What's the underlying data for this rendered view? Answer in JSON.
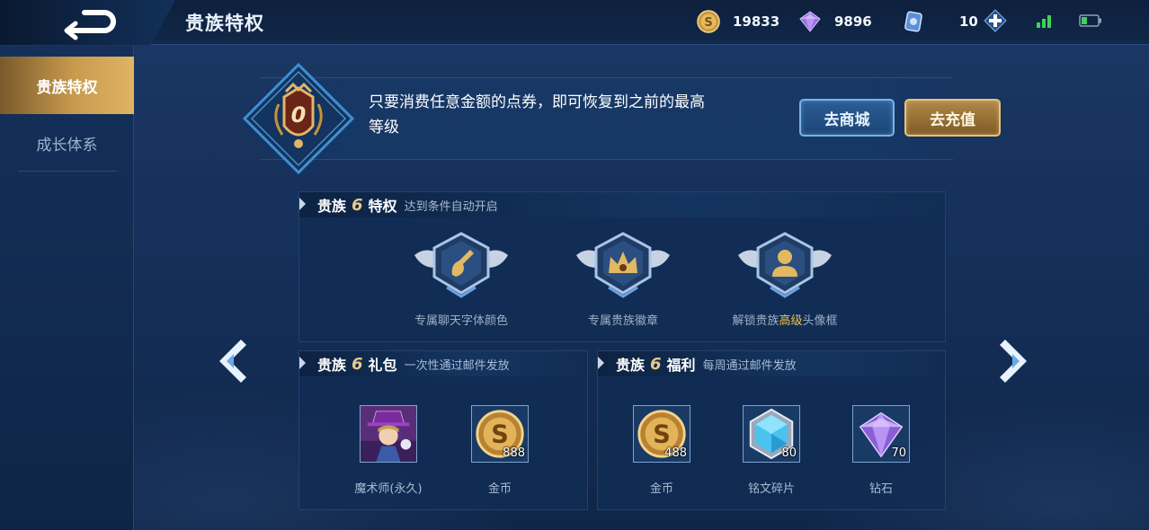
{
  "header": {
    "title": "贵族特权",
    "gold": "19833",
    "diamonds": "9896",
    "coupons": "10"
  },
  "sidebar": {
    "items": [
      {
        "label": "贵族特权",
        "active": true
      },
      {
        "label": "成长体系",
        "active": false
      }
    ]
  },
  "info": {
    "vip_level": "0",
    "message": "只要消费任意金额的点券，即可恢复到之前的最高等级",
    "shop_label": "去商城",
    "recharge_label": "去充值"
  },
  "privileges": {
    "title_prefix": "贵族",
    "level": "6",
    "title_suffix": "特权",
    "subtitle": "达到条件自动开启",
    "items": [
      {
        "label": "专属聊天字体颜色",
        "icon": "brush-icon"
      },
      {
        "label": "专属贵族徽章",
        "icon": "crown-badge-icon"
      },
      {
        "label_pre": "解锁贵族",
        "label_hl": "高级",
        "label_post": "头像框",
        "icon": "avatar-frame-icon"
      }
    ]
  },
  "gift": {
    "title_prefix": "贵族",
    "level": "6",
    "title_suffix": "礼包",
    "subtitle": "一次性通过邮件发放",
    "items": [
      {
        "label": "魔术师(永久)",
        "qty": "",
        "icon": "magician-skin-icon"
      },
      {
        "label": "金币",
        "qty": "888",
        "icon": "gold-coin-icon"
      }
    ]
  },
  "welfare": {
    "title_prefix": "贵族",
    "level": "6",
    "title_suffix": "福利",
    "subtitle": "每周通过邮件发放",
    "items": [
      {
        "label": "金币",
        "qty": "488",
        "icon": "gold-coin-icon"
      },
      {
        "label": "铭文碎片",
        "qty": "80",
        "icon": "inscription-shard-icon"
      },
      {
        "label": "钻石",
        "qty": "70",
        "icon": "diamond-icon"
      }
    ]
  },
  "colors": {
    "gold_accent": "#e0b464",
    "highlight": "#f0c24a",
    "panel_bg": "#112d54",
    "page_bg": "#15305a"
  }
}
